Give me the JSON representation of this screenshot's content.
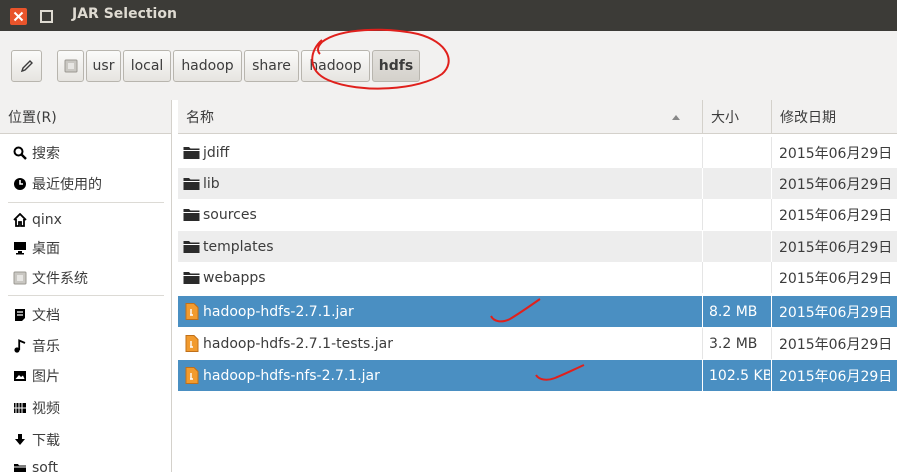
{
  "window": {
    "title": "JAR Selection"
  },
  "pathbar": {
    "segments": [
      "usr",
      "local",
      "hadoop",
      "share",
      "hadoop",
      "hdfs"
    ]
  },
  "sidebar": {
    "header": "位置(R)",
    "items": [
      {
        "label": "搜索",
        "icon": "search-icon"
      },
      {
        "label": "最近使用的",
        "icon": "recent-icon"
      },
      {
        "label": "qinx",
        "icon": "home-icon"
      },
      {
        "label": "桌面",
        "icon": "desktop-icon"
      },
      {
        "label": "文件系统",
        "icon": "filesystem-icon"
      },
      {
        "label": "文档",
        "icon": "documents-icon"
      },
      {
        "label": "音乐",
        "icon": "music-icon"
      },
      {
        "label": "图片",
        "icon": "pictures-icon"
      },
      {
        "label": "视频",
        "icon": "videos-icon"
      },
      {
        "label": "下载",
        "icon": "download-icon"
      },
      {
        "label": "soft",
        "icon": "folder-icon"
      }
    ]
  },
  "filelist": {
    "columns": {
      "name": "名称",
      "size": "大小",
      "date": "修改日期"
    },
    "rows": [
      {
        "name": "jdiff",
        "size": "",
        "date": "2015年06月29日",
        "type": "folder"
      },
      {
        "name": "lib",
        "size": "",
        "date": "2015年06月29日",
        "type": "folder"
      },
      {
        "name": "sources",
        "size": "",
        "date": "2015年06月29日",
        "type": "folder"
      },
      {
        "name": "templates",
        "size": "",
        "date": "2015年06月29日",
        "type": "folder"
      },
      {
        "name": "webapps",
        "size": "",
        "date": "2015年06月29日",
        "type": "folder"
      },
      {
        "name": "hadoop-hdfs-2.7.1.jar",
        "size": "8.2 MB",
        "date": "2015年06月29日",
        "type": "jar",
        "selected": true
      },
      {
        "name": "hadoop-hdfs-2.7.1-tests.jar",
        "size": "3.2 MB",
        "date": "2015年06月29日",
        "type": "jar",
        "selected": false
      },
      {
        "name": "hadoop-hdfs-nfs-2.7.1.jar",
        "size": "102.5 KB",
        "date": "2015年06月29日",
        "type": "jar",
        "selected": true
      }
    ]
  },
  "colors": {
    "selection": "#4a8fc2",
    "titlebar": "#3c3b37",
    "close": "#e9542b",
    "annotation": "#e0201c"
  }
}
